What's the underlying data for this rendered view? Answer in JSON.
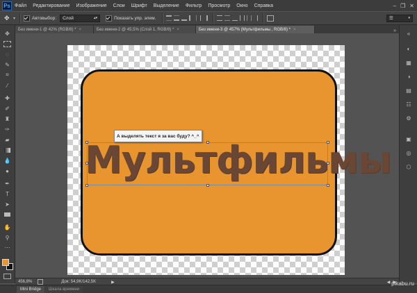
{
  "app": {
    "logo": "Ps"
  },
  "menu": [
    "Файл",
    "Редактирование",
    "Изображение",
    "Слои",
    "Шрифт",
    "Выделение",
    "Фильтр",
    "Просмотр",
    "Окно",
    "Справка"
  ],
  "options": {
    "autoselect_label": "Автовыбор:",
    "autoselect_value": "Слой",
    "show_controls_label": "Показать упр. элем."
  },
  "tabs": [
    {
      "label": "Без имени-1 @ 42% (RGB/8) *",
      "close": "×"
    },
    {
      "label": "Без имени-2 @ 45,5% (Слой 1, RGB/8) *",
      "close": "×"
    },
    {
      "label": "Без имени-3 @ 457% (Мультфильмы , RGB/8) *",
      "close": "×"
    }
  ],
  "canvas": {
    "text_layer": "Мультфильмы",
    "tooltip": "А выделять текст я за вас буду? ^_^",
    "plate_color": "#e8952f",
    "text_color": "#6a4634"
  },
  "colors": {
    "foreground": "#e8952f",
    "background": "#111111"
  },
  "status": {
    "zoom": "456,8%",
    "doc": "Док: 54,9K/142,5K"
  },
  "bottom_tabs": [
    "Mini Bridge",
    "Шкала времени"
  ],
  "watermark": "pikabu.ru"
}
